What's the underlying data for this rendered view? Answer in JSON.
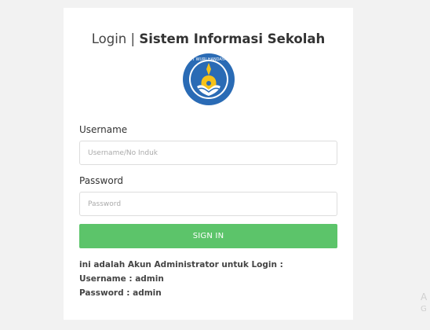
{
  "header": {
    "login_text": "Login",
    "separator": "|",
    "app_name": "Sistem Informasi Sekolah"
  },
  "logo": {
    "icon": "tut-wuri-handayani-emblem",
    "emblem_text": "TUT WURI HANDAYANI",
    "colors": {
      "blue": "#2a6bb5",
      "yellow": "#f6c21a",
      "white": "#ffffff"
    }
  },
  "form": {
    "username_label": "Username",
    "username_placeholder": "Username/No Induk",
    "password_label": "Password",
    "password_placeholder": "Password",
    "submit_label": "SIGN IN",
    "button_color": "#5cc46a"
  },
  "info": {
    "line1": "ini adalah Akun Administrator untuk Login :",
    "line2": "Username : admin",
    "line3": "Password : admin"
  },
  "watermark": {
    "line1": "A",
    "line2": "G"
  }
}
